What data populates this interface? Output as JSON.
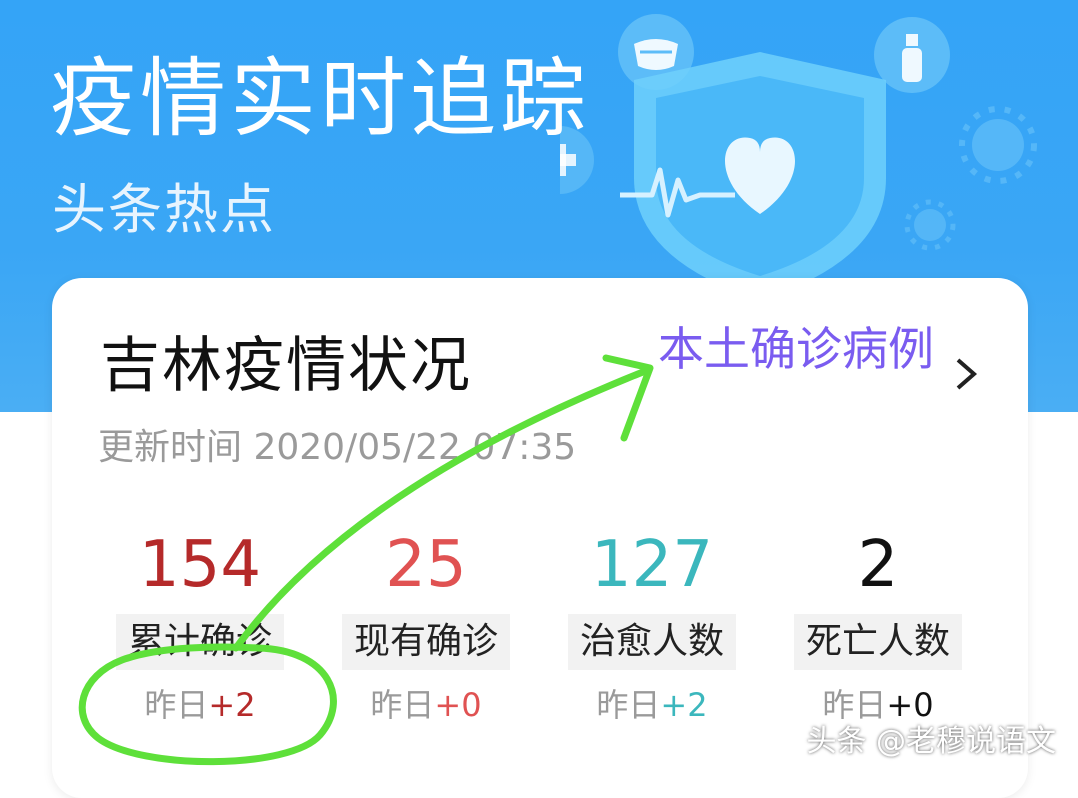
{
  "banner": {
    "title": "疫情实时追踪",
    "subtitle": "头条热点"
  },
  "card": {
    "title": "吉林疫情状况",
    "link_label": "本土确诊病例",
    "link_color": "#7a5cf0",
    "update_time": "更新时间 2020/05/22 07:35",
    "stats": [
      {
        "value": "154",
        "label": "累计确诊",
        "delta_prefix": "昨日",
        "delta": "+2",
        "color": "#b52a2a"
      },
      {
        "value": "25",
        "label": "现有确诊",
        "delta_prefix": "昨日",
        "delta": "+0",
        "color": "#e05252"
      },
      {
        "value": "127",
        "label": "治愈人数",
        "delta_prefix": "昨日",
        "delta": "+2",
        "color": "#3bb7bd"
      },
      {
        "value": "2",
        "label": "死亡人数",
        "delta_prefix": "昨日",
        "delta": "+0",
        "color": "#111111"
      }
    ]
  },
  "watermark": "头条 @老穆说语文",
  "icons": [
    "mask-icon",
    "spray-bottle-icon",
    "virus-icon",
    "medical-cross-icon",
    "shield-heart-icon",
    "heartbeat-line-icon",
    "chevron-right-icon"
  ],
  "annotation_color": "#5ee03a"
}
